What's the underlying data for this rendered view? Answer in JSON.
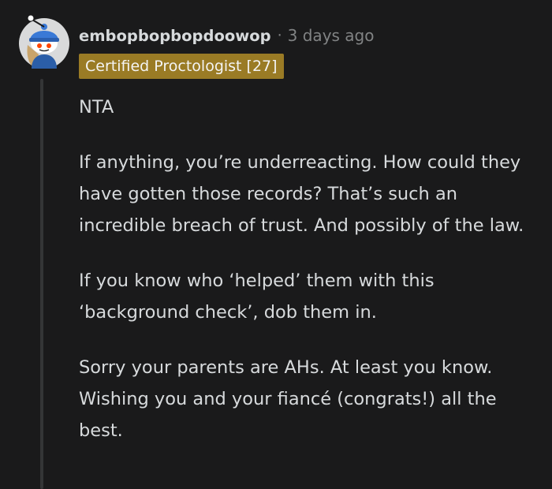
{
  "comment": {
    "username": "embopbopbopdoowop",
    "separator": "·",
    "timestamp": "3 days ago",
    "flair": "Certified Proctologist [27]",
    "avatar_icon": "reddit-snoo-avatar-icon",
    "paragraphs": [
      "NTA",
      "If anything, you’re underreacting. How could they have gotten those records? That’s such an incredible breach of trust. And possibly of the law.",
      "If you know who ‘helped’ them with this ‘background check’, dob them in.",
      "Sorry your parents are AHs. At least you know. Wishing you and your fiancé (congrats!) all the best."
    ]
  },
  "colors": {
    "background": "#1a1a1b",
    "text": "#d7dadc",
    "meta": "#818384",
    "flair_bg": "#9a7b25",
    "thread_line": "#343536"
  }
}
